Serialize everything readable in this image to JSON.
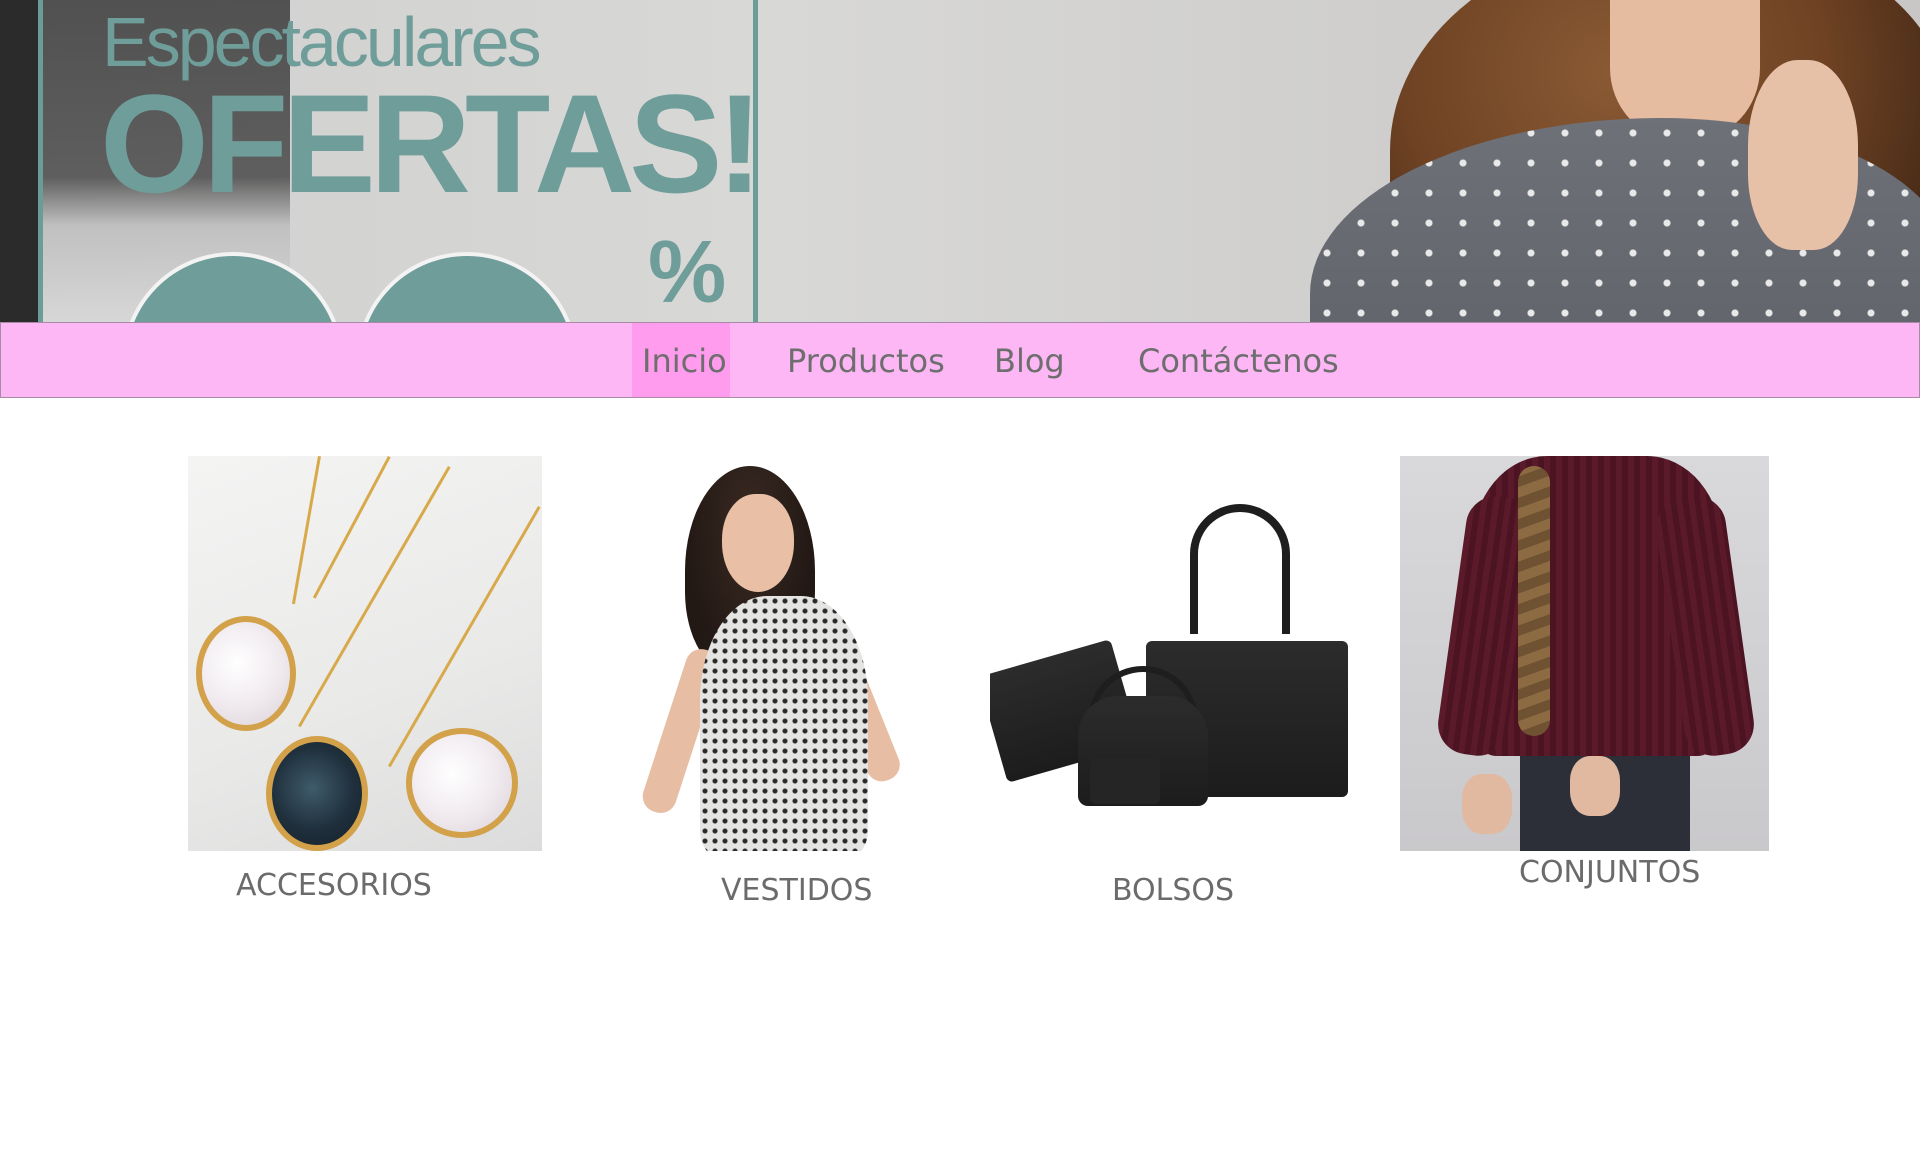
{
  "banner": {
    "line1": "Espectaculares",
    "line2": "OFERTAS!",
    "percent": "%",
    "accent_color": "#6f9d99"
  },
  "nav": {
    "background": "#fdb7f5",
    "active_background": "#ff9cee",
    "items": [
      {
        "label": "Inicio",
        "active": true
      },
      {
        "label": "Productos",
        "active": false
      },
      {
        "label": "Blog",
        "active": false
      },
      {
        "label": "Contáctenos",
        "active": false
      }
    ]
  },
  "categories": [
    {
      "label": "ACCESORIOS",
      "image": "necklaces-photo"
    },
    {
      "label": "VESTIDOS",
      "image": "dress-photo"
    },
    {
      "label": "BOLSOS",
      "image": "handbags-photo"
    },
    {
      "label": "CONJUNTOS",
      "image": "sweater-outfit-photo"
    }
  ]
}
